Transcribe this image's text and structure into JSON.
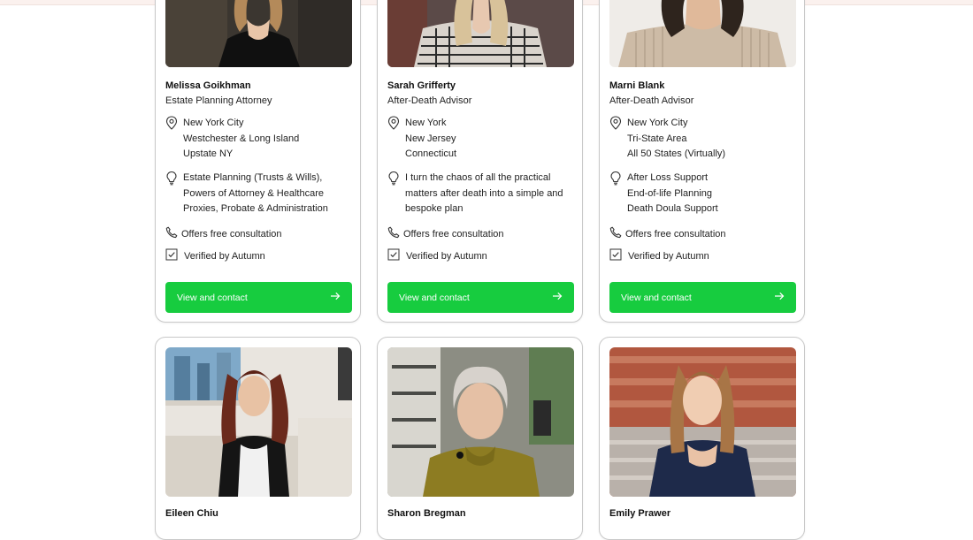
{
  "cards": [
    {
      "name": "Melissa Goikhman",
      "role": "Estate Planning Attorney",
      "locations": [
        "New York City",
        "Westchester & Long Island",
        "Upstate NY"
      ],
      "specialties": [
        "Estate Planning (Trusts & Wills),",
        "Powers of Attorney & Healthcare",
        "Proxies, Probate & Administration"
      ],
      "consultation": "Offers free consultation",
      "verified": "Verified by Autumn",
      "button": "View and contact"
    },
    {
      "name": "Sarah Grifferty",
      "role": "After-Death Advisor",
      "locations": [
        "New York",
        "New Jersey",
        "Connecticut"
      ],
      "specialties": [
        "I turn the chaos of all the practical",
        "matters after death into a simple and",
        "bespoke plan"
      ],
      "consultation": "Offers free consultation",
      "verified": "Verified by Autumn",
      "button": "View and contact"
    },
    {
      "name": "Marni Blank",
      "role": "After-Death Advisor",
      "locations": [
        "New York City",
        "Tri-State Area",
        "All 50 States (Virtually)"
      ],
      "specialties": [
        "After Loss Support",
        "End-of-life Planning",
        "Death Doula Support"
      ],
      "consultation": "Offers free consultation",
      "verified": "Verified by Autumn",
      "button": "View and contact"
    }
  ],
  "bottom_cards": [
    {
      "name": "Eileen Chiu"
    },
    {
      "name": "Sharon Bregman"
    },
    {
      "name": "Emily Prawer"
    }
  ],
  "colors": {
    "accent": "#17cc3f",
    "border": "#c9c9c9"
  },
  "icons": [
    "location-pin-icon",
    "lightbulb-icon",
    "phone-icon",
    "checkbox-check-icon",
    "arrow-right-icon"
  ]
}
